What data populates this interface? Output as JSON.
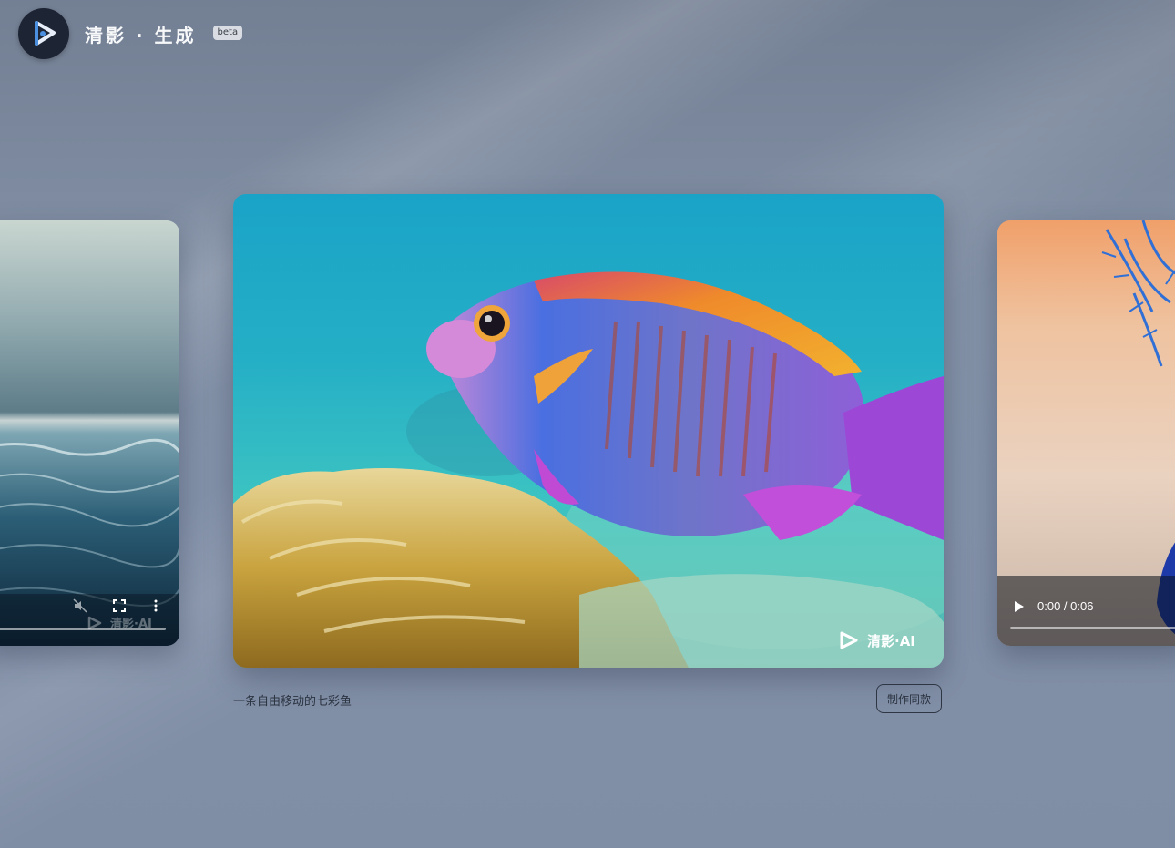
{
  "header": {
    "brand": "清影 · 生成",
    "badge": "beta"
  },
  "main_card": {
    "watermark": "清影·AI",
    "caption": "一条自由移动的七彩鱼",
    "make_same_label": "制作同款"
  },
  "left_card": {
    "watermark": "清影·AI"
  },
  "right_card": {
    "time": "0:00 / 0:06"
  },
  "colors": {
    "logo_bg": "#1d2433",
    "logo_accent": "#4a8fe0",
    "page_bg": "#8290a8"
  },
  "icons": [
    "logo-icon",
    "mute-icon",
    "fullscreen-icon",
    "more-icon",
    "play-icon",
    "watermark-logo-icon"
  ]
}
